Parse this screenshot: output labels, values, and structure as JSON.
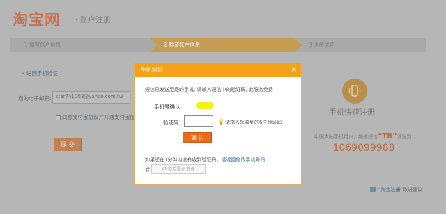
{
  "header": {
    "logo_text": "淘宝网",
    "subtitle": "· 账户注册"
  },
  "steps": [
    {
      "label": "1 填写账户信息"
    },
    {
      "label": "2 验证账户信息"
    },
    {
      "label": "3 注册成功"
    }
  ],
  "form": {
    "back_link": "« 返回手机验证",
    "email_label": "您的电子邮箱:",
    "email_value": "star741003@yahoo.com.tw",
    "agree_prefix": "同意",
    "agree_link": "支付宝协议",
    "agree_suffix": "并开通支付宝服务",
    "submit_label": "提 交"
  },
  "right_panel": {
    "title": "手机快速注册",
    "desc_prefix": "中国大陆手机用户，编辑短信",
    "desc_tb": "“TB”",
    "desc_suffix": "发送到:",
    "number": "1069099988"
  },
  "suggest": {
    "link": "“淘宝注册”",
    "suffix": "改进建议"
  },
  "modal": {
    "title": "手机验证",
    "close": "×",
    "message": "短信已发送至您的手机, 请输入短信中的验证码, 此服务免费",
    "phone_label": "手机号确认:",
    "code_label": "验证码:",
    "code_value": "",
    "hint": "请输入您收到的6位验证码",
    "confirm_label": "确 认",
    "resend_prefix": "如果您在1分钟内没有收到验证码，请",
    "resend_link": "返回修改手机号码",
    "resend_or": "或",
    "resend_button": "48秒后重新发送"
  },
  "colors": {
    "accent_orange": "#f5a21b",
    "confirm_orange": "#e86b1c",
    "highlight_yellow": "#f2f21a",
    "link_blue": "#3d6fb0"
  }
}
